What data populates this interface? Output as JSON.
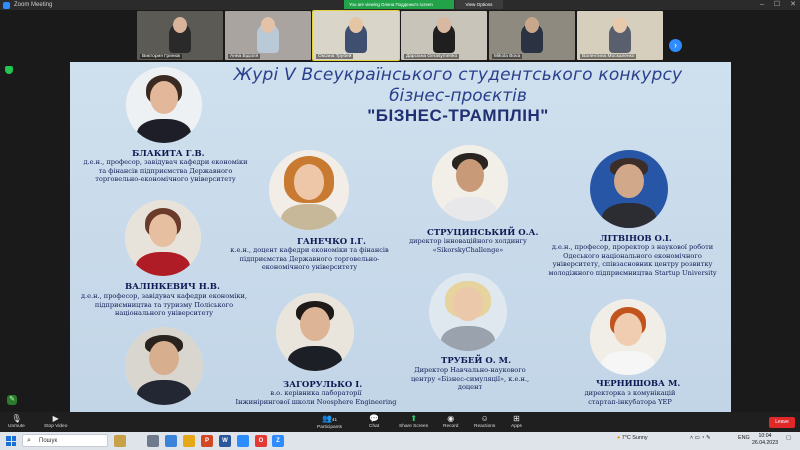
{
  "window": {
    "title": "Zoom Meeting"
  },
  "share_banner": {
    "text": "You are viewing Олена Подденко's screen",
    "button": "View Options"
  },
  "participants": [
    {
      "name": "Виктория Гринюк"
    },
    {
      "name": "Анна Бідзіля"
    },
    {
      "name": "Оксана Трубей"
    },
    {
      "name": "Дарсіана Gerasymenko"
    },
    {
      "name": "Mikola Bova"
    },
    {
      "name": "Валентина Москаленко"
    }
  ],
  "slide": {
    "title_line1": "Журі V Всеукраїнського студентського конкурсу",
    "title_line2": "бізнес-проєктів",
    "title_line3": "\"БІЗНЕС-ТРАМПЛІН\"",
    "jury": [
      {
        "name": "БЛАКИТА Г.В.",
        "desc": [
          "д.е.н., професор, завідувач кафедри економіки",
          "та фінансів підприємства Державного",
          "торговельно-економічного університету"
        ]
      },
      {
        "name": "ГАНЕЧКО І.Г.",
        "desc": [
          "к.е.н.,  доцент кафедри економіки та фінансів",
          "підприємства Державного торговельно-",
          "економічного університету"
        ]
      },
      {
        "name": "СТРУЦИНСЬКИЙ О.А.",
        "desc": [
          "директор інноваційного холдингу",
          "«SikorskyChallenge»"
        ]
      },
      {
        "name": "ЛІТВІНОВ О.І.",
        "desc": [
          "д.е.н., професор, проректор з наукової роботи",
          "Одеського національного економічного",
          "університету, співзасновник центру розвитку",
          "молодіжного підприємництва Startup University"
        ]
      },
      {
        "name": "ВАЛІНКЕВИЧ Н.В.",
        "desc": [
          "д.е.н., професор, завідувач кафедри економіки,",
          "підприємництва та туризму Поліського",
          "національного університету"
        ]
      },
      {
        "name": "ЗАГОРУЛЬКО І.",
        "desc": [
          "в.о. керівника лабораторії",
          "Інжинірингової школи Noosphere Engineering"
        ]
      },
      {
        "name": "ТРУБЕЙ О. М.",
        "desc": [
          "Директор Навчально-наукового",
          "центру «Бізнес-симуляції», к.е.н.,",
          "доцент"
        ]
      },
      {
        "name": "ЧЕРНИШОВА М.",
        "desc": [
          "директорка з комунікацій",
          "стартап-інкубатора YEP"
        ]
      }
    ]
  },
  "toolbar": {
    "unmute": "Unmute",
    "stop_video": "Stop Video",
    "participants": "Participants",
    "participants_count": "41",
    "chat": "Chat",
    "share_screen": "Share Screen",
    "record": "Record",
    "reactions": "Reactions",
    "apps": "Apps",
    "leave": "Leave"
  },
  "taskbar": {
    "search_placeholder": "Пошук",
    "weather": "7°C  Sunny",
    "lang": "ENG",
    "time": "10:04",
    "date": "26.04.2023"
  },
  "colors": {
    "title_blue": "#2a3f8c",
    "zoom_blue": "#2d8cff",
    "leave_red": "#e02828",
    "banner_green": "#22a34a"
  }
}
